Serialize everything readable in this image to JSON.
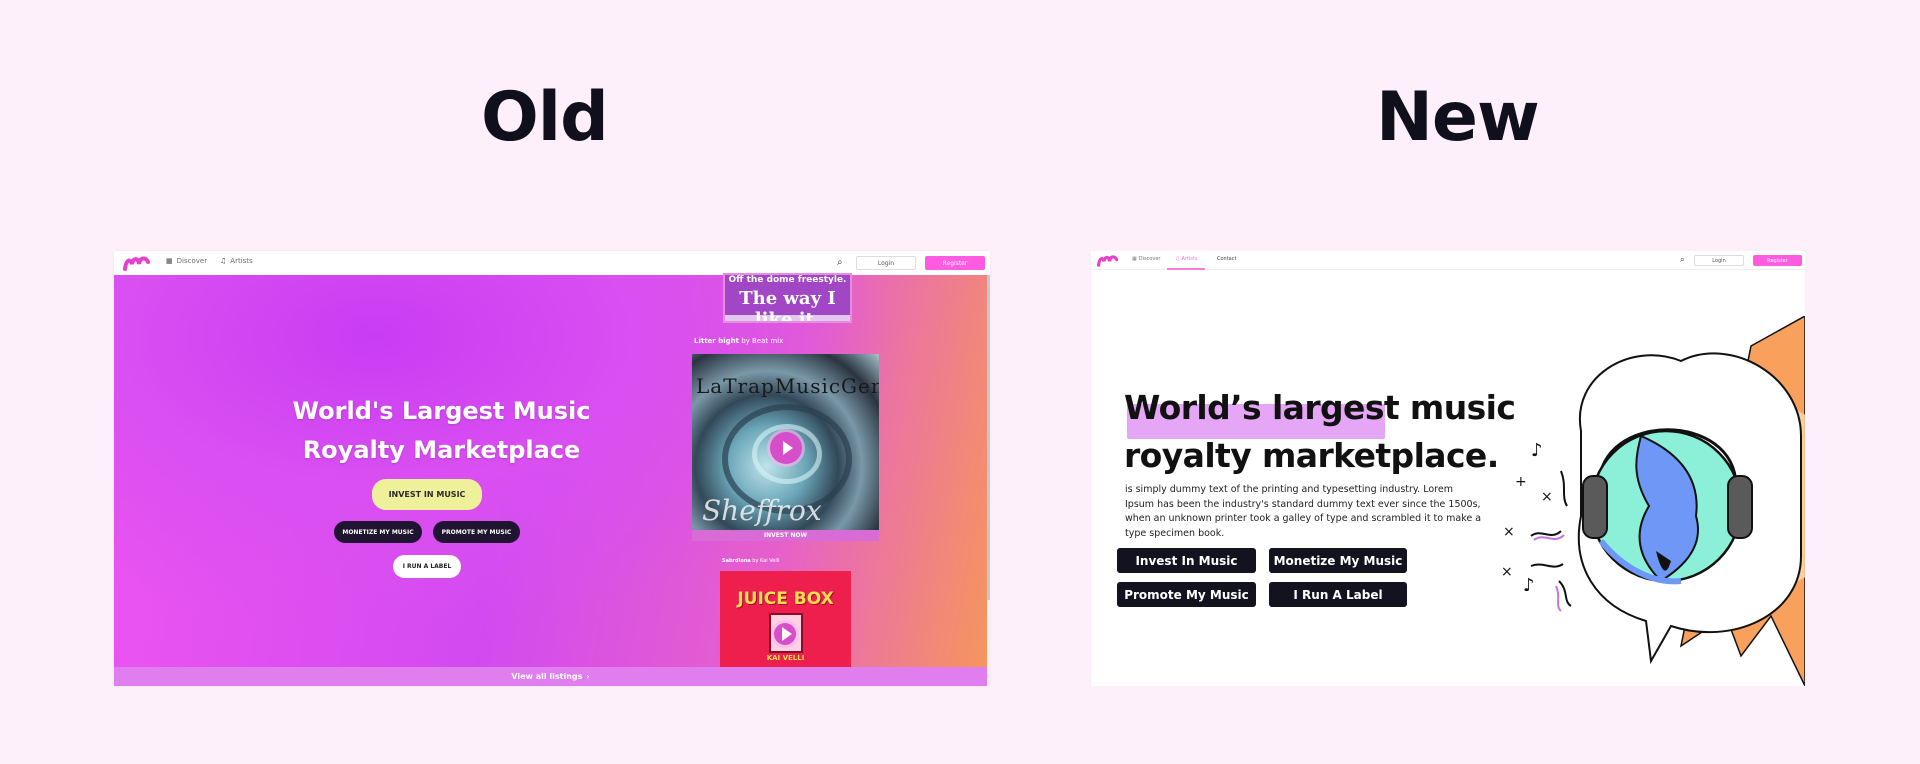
{
  "headings": {
    "old": "Old",
    "new": "New"
  },
  "old_panel": {
    "nav": {
      "discover": "Discover",
      "artists": "Artists",
      "login": "Login",
      "register": "Register"
    },
    "hero": {
      "title_line1": "World's Largest Music",
      "title_line2": "Royalty Marketplace",
      "invest_button": "INVEST IN MUSIC",
      "monetize_button": "MONETIZE MY MUSIC",
      "promote_button": "PROMOTE MY MUSIC",
      "label_button": "I RUN A LABEL"
    },
    "listings": {
      "top_card_line1": "Off the dome freestyle.",
      "top_card_line2": "The way I like it.",
      "main_card_title": "Litter bight",
      "main_card_by": "by Beat mix",
      "main_card_art_text": "LaTrapMusicGeneration",
      "main_card_art_text2": "Sheffrox",
      "invest_now": "INVEST NOW",
      "third_card_title": "Sabrdlona",
      "third_card_by": "by Kai Velli",
      "third_card_art": "JUICE BOX",
      "third_card_art2": "KAI VELLI",
      "view_all": "View all listings"
    },
    "colors": {
      "accent": "#ff5be0",
      "yellow_pill": "#eef19a",
      "dark_pill": "#1f1530"
    }
  },
  "new_panel": {
    "nav": {
      "discover": "Discover",
      "artists": "Artists",
      "contact": "Contact",
      "login": "Login",
      "register": "Register"
    },
    "title_line1": "World’s largest music",
    "title_line2": "royalty marketplace.",
    "body": "is simply dummy text of the printing and typesetting industry. Lorem Ipsum has been the industry's standard dummy text ever since the 1500s, when an unknown printer took a galley of type and scrambled it to make a type specimen book.",
    "buttons": {
      "invest": "Invest In Music",
      "monetize": "Monetize My Music",
      "promote": "Promote My Music",
      "label": "I Run A Label"
    },
    "colors": {
      "highlight": "#e4a6f5",
      "button": "#12131e",
      "accent": "#ff6fd8"
    }
  }
}
